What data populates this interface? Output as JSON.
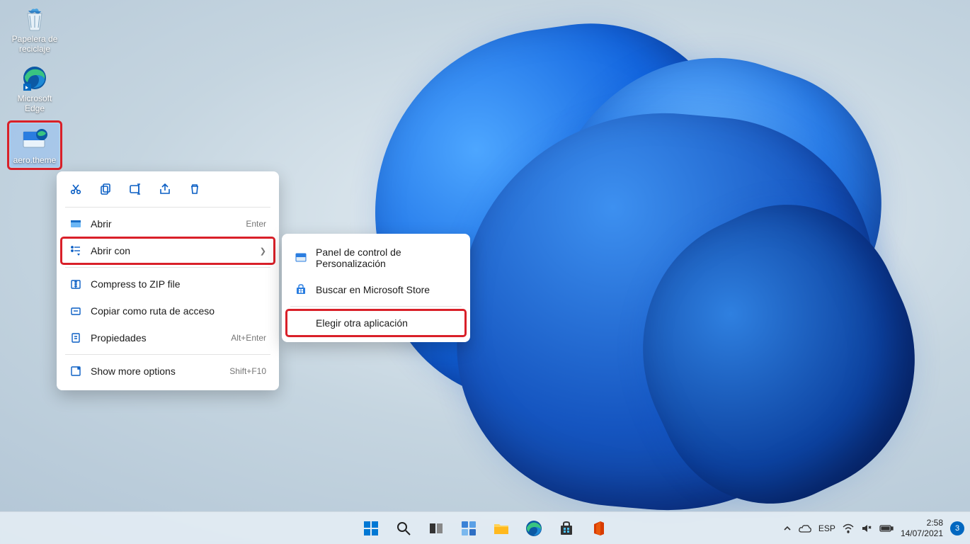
{
  "desktop": {
    "icons": [
      {
        "name": "recycle-bin",
        "label": "Papelera de reciclaje"
      },
      {
        "name": "microsoft-edge",
        "label": "Microsoft Edge"
      },
      {
        "name": "aero-theme-file",
        "label": "aero.theme"
      }
    ]
  },
  "context_menu": {
    "toolbar_icons": [
      "cut",
      "copy",
      "rename",
      "share",
      "delete"
    ],
    "items": [
      {
        "icon": "open",
        "label": "Abrir",
        "accel": "Enter"
      },
      {
        "icon": "openwith",
        "label": "Abrir con",
        "submenu": true,
        "highlighted": true
      },
      {
        "icon": "zip",
        "label": "Compress to ZIP file"
      },
      {
        "icon": "copypath",
        "label": "Copiar como ruta de acceso"
      },
      {
        "icon": "props",
        "label": "Propiedades",
        "accel": "Alt+Enter"
      },
      {
        "icon": "more",
        "label": "Show more options",
        "accel": "Shift+F10"
      }
    ]
  },
  "submenu": {
    "items": [
      {
        "icon": "personalization",
        "label": "Panel de control de Personalización"
      },
      {
        "icon": "store",
        "label": "Buscar en Microsoft Store"
      },
      {
        "icon": "none",
        "label": "Elegir otra aplicación",
        "highlighted": true
      }
    ]
  },
  "taskbar": {
    "apps": [
      "start",
      "search",
      "taskview",
      "widgets",
      "explorer",
      "edge",
      "store",
      "office"
    ],
    "tray": {
      "lang": "ESP",
      "time": "2:58",
      "date": "14/07/2021",
      "notif_count": "3"
    }
  }
}
